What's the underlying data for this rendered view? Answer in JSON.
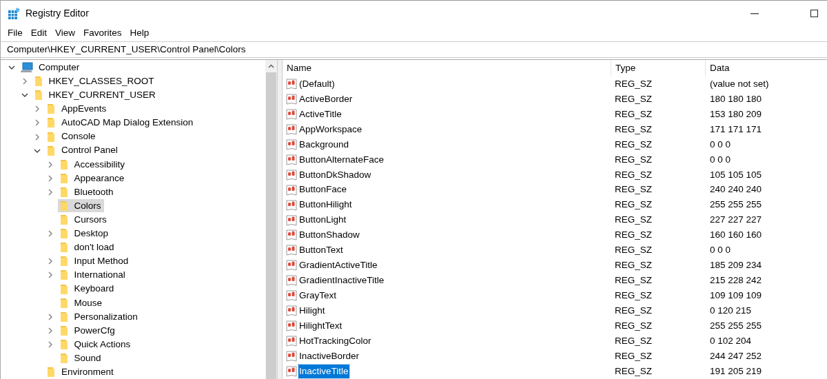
{
  "window": {
    "title": "Registry Editor"
  },
  "menu": [
    "File",
    "Edit",
    "View",
    "Favorites",
    "Help"
  ],
  "address": "Computer\\HKEY_CURRENT_USER\\Control Panel\\Colors",
  "tree": [
    {
      "label": "Computer",
      "kind": "computer",
      "expanded": true,
      "selected": false,
      "children": [
        {
          "label": "HKEY_CLASSES_ROOT",
          "kind": "folder",
          "expanded": false,
          "selected": false
        },
        {
          "label": "HKEY_CURRENT_USER",
          "kind": "folder",
          "expanded": true,
          "selected": false,
          "children": [
            {
              "label": "AppEvents",
              "kind": "folder",
              "expanded": false,
              "selected": false
            },
            {
              "label": "AutoCAD Map Dialog Extension",
              "kind": "folder",
              "expanded": false,
              "selected": false
            },
            {
              "label": "Console",
              "kind": "folder",
              "expanded": false,
              "selected": false
            },
            {
              "label": "Control Panel",
              "kind": "folder",
              "expanded": true,
              "selected": false,
              "children": [
                {
                  "label": "Accessibility",
                  "kind": "folder",
                  "expanded": false,
                  "selected": false
                },
                {
                  "label": "Appearance",
                  "kind": "folder",
                  "expanded": false,
                  "selected": false
                },
                {
                  "label": "Bluetooth",
                  "kind": "folder",
                  "expanded": false,
                  "selected": false
                },
                {
                  "label": "Colors",
                  "kind": "folder",
                  "selected": true
                },
                {
                  "label": "Cursors",
                  "kind": "folder",
                  "selected": false
                },
                {
                  "label": "Desktop",
                  "kind": "folder",
                  "expanded": false,
                  "selected": false
                },
                {
                  "label": "don't load",
                  "kind": "folder",
                  "selected": false
                },
                {
                  "label": "Input Method",
                  "kind": "folder",
                  "expanded": false,
                  "selected": false
                },
                {
                  "label": "International",
                  "kind": "folder",
                  "expanded": false,
                  "selected": false
                },
                {
                  "label": "Keyboard",
                  "kind": "folder",
                  "selected": false
                },
                {
                  "label": "Mouse",
                  "kind": "folder",
                  "selected": false
                },
                {
                  "label": "Personalization",
                  "kind": "folder",
                  "expanded": false,
                  "selected": false
                },
                {
                  "label": "PowerCfg",
                  "kind": "folder",
                  "expanded": false,
                  "selected": false
                },
                {
                  "label": "Quick Actions",
                  "kind": "folder",
                  "expanded": false,
                  "selected": false
                },
                {
                  "label": "Sound",
                  "kind": "folder",
                  "selected": false
                }
              ]
            },
            {
              "label": "Environment",
              "kind": "folder",
              "selected": false
            }
          ]
        }
      ]
    }
  ],
  "table": {
    "columns": [
      "Name",
      "Type",
      "Data"
    ],
    "rows": [
      {
        "name": "(Default)",
        "type": "REG_SZ",
        "data": "(value not set)",
        "selected": false
      },
      {
        "name": "ActiveBorder",
        "type": "REG_SZ",
        "data": "180 180 180",
        "selected": false
      },
      {
        "name": "ActiveTitle",
        "type": "REG_SZ",
        "data": "153 180 209",
        "selected": false
      },
      {
        "name": "AppWorkspace",
        "type": "REG_SZ",
        "data": "171 171 171",
        "selected": false
      },
      {
        "name": "Background",
        "type": "REG_SZ",
        "data": "0 0 0",
        "selected": false
      },
      {
        "name": "ButtonAlternateFace",
        "type": "REG_SZ",
        "data": "0 0 0",
        "selected": false
      },
      {
        "name": "ButtonDkShadow",
        "type": "REG_SZ",
        "data": "105 105 105",
        "selected": false
      },
      {
        "name": "ButtonFace",
        "type": "REG_SZ",
        "data": "240 240 240",
        "selected": false
      },
      {
        "name": "ButtonHilight",
        "type": "REG_SZ",
        "data": "255 255 255",
        "selected": false
      },
      {
        "name": "ButtonLight",
        "type": "REG_SZ",
        "data": "227 227 227",
        "selected": false
      },
      {
        "name": "ButtonShadow",
        "type": "REG_SZ",
        "data": "160 160 160",
        "selected": false
      },
      {
        "name": "ButtonText",
        "type": "REG_SZ",
        "data": "0 0 0",
        "selected": false
      },
      {
        "name": "GradientActiveTitle",
        "type": "REG_SZ",
        "data": "185 209 234",
        "selected": false
      },
      {
        "name": "GradientInactiveTitle",
        "type": "REG_SZ",
        "data": "215 228 242",
        "selected": false
      },
      {
        "name": "GrayText",
        "type": "REG_SZ",
        "data": "109 109 109",
        "selected": false
      },
      {
        "name": "Hilight",
        "type": "REG_SZ",
        "data": "0 120 215",
        "selected": false
      },
      {
        "name": "HilightText",
        "type": "REG_SZ",
        "data": "255 255 255",
        "selected": false
      },
      {
        "name": "HotTrackingColor",
        "type": "REG_SZ",
        "data": "0 102 204",
        "selected": false
      },
      {
        "name": "InactiveBorder",
        "type": "REG_SZ",
        "data": "244 247 252",
        "selected": false
      },
      {
        "name": "InactiveTitle",
        "type": "REG_SZ",
        "data": "191 205 219",
        "selected": true
      }
    ]
  }
}
